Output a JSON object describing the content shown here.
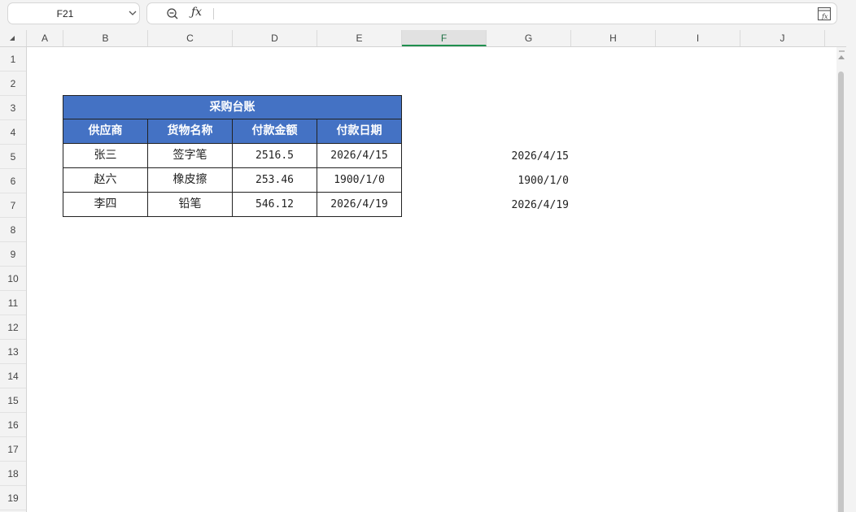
{
  "formula_bar": {
    "name_box": "F21",
    "formula_value": ""
  },
  "columns": [
    "A",
    "B",
    "C",
    "D",
    "E",
    "F",
    "G",
    "H",
    "I",
    "J"
  ],
  "selected_column": "F",
  "rows": [
    "1",
    "2",
    "3",
    "4",
    "5",
    "6",
    "7",
    "8",
    "9",
    "10",
    "11",
    "12",
    "13",
    "14",
    "15",
    "16",
    "17",
    "18",
    "19"
  ],
  "ledger": {
    "title": "采购台账",
    "headers": [
      "供应商",
      "货物名称",
      "付款金额",
      "付款日期"
    ],
    "records": [
      [
        "张三",
        "签字笔",
        "2516.5",
        "2026/4/15"
      ],
      [
        "赵六",
        "橡皮擦",
        "253.46",
        "1900/1/0"
      ],
      [
        "李四",
        "铅笔",
        "546.12",
        "2026/4/19"
      ]
    ]
  },
  "g_column_values": [
    "2026/4/15",
    "1900/1/0",
    "2026/4/19"
  ],
  "colors": {
    "header_fill": "#4472c4",
    "selected_header_accent": "#1f8f4e"
  },
  "icons": {
    "name_box_dropdown": "chevron-down-icon",
    "zoom": "zoom-out-icon",
    "fx": "fx-icon",
    "expand_formula": "expand-formula-icon",
    "corner": "select-all-triangle-icon"
  }
}
